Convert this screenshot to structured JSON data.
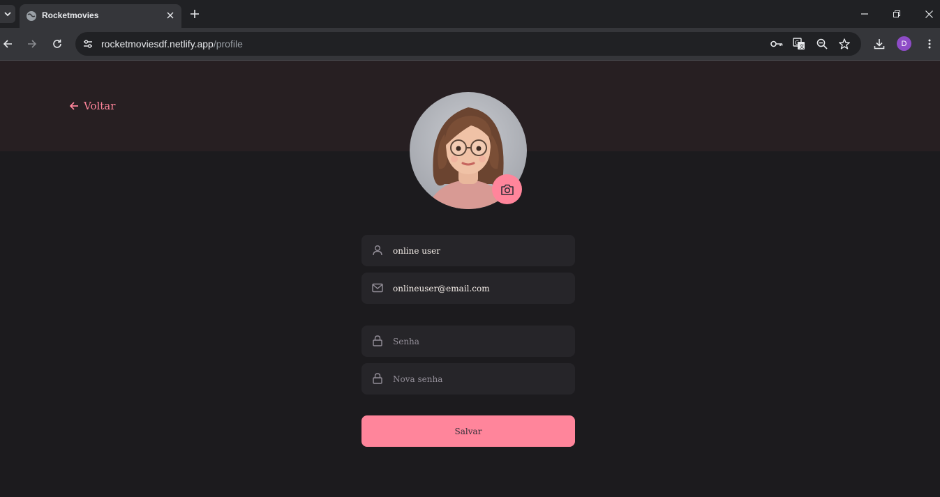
{
  "browser": {
    "tab_title": "Rocketmovies",
    "url_host": "rocketmoviesdf.netlify.app",
    "url_path": "/profile",
    "profile_initial": "D"
  },
  "page": {
    "back_label": "Voltar",
    "fields": {
      "name_value": "online user",
      "email_value": "onlineuser@email.com",
      "password_placeholder": "Senha",
      "new_password_placeholder": "Nova senha"
    },
    "save_label": "Salvar"
  },
  "colors": {
    "accent": "#ff859b",
    "background": "#1c1b1e",
    "header_background": "#271f22",
    "input_background": "#262529"
  },
  "icons": [
    "arrow-left-icon",
    "camera-icon",
    "user-icon",
    "mail-icon",
    "lock-icon"
  ]
}
